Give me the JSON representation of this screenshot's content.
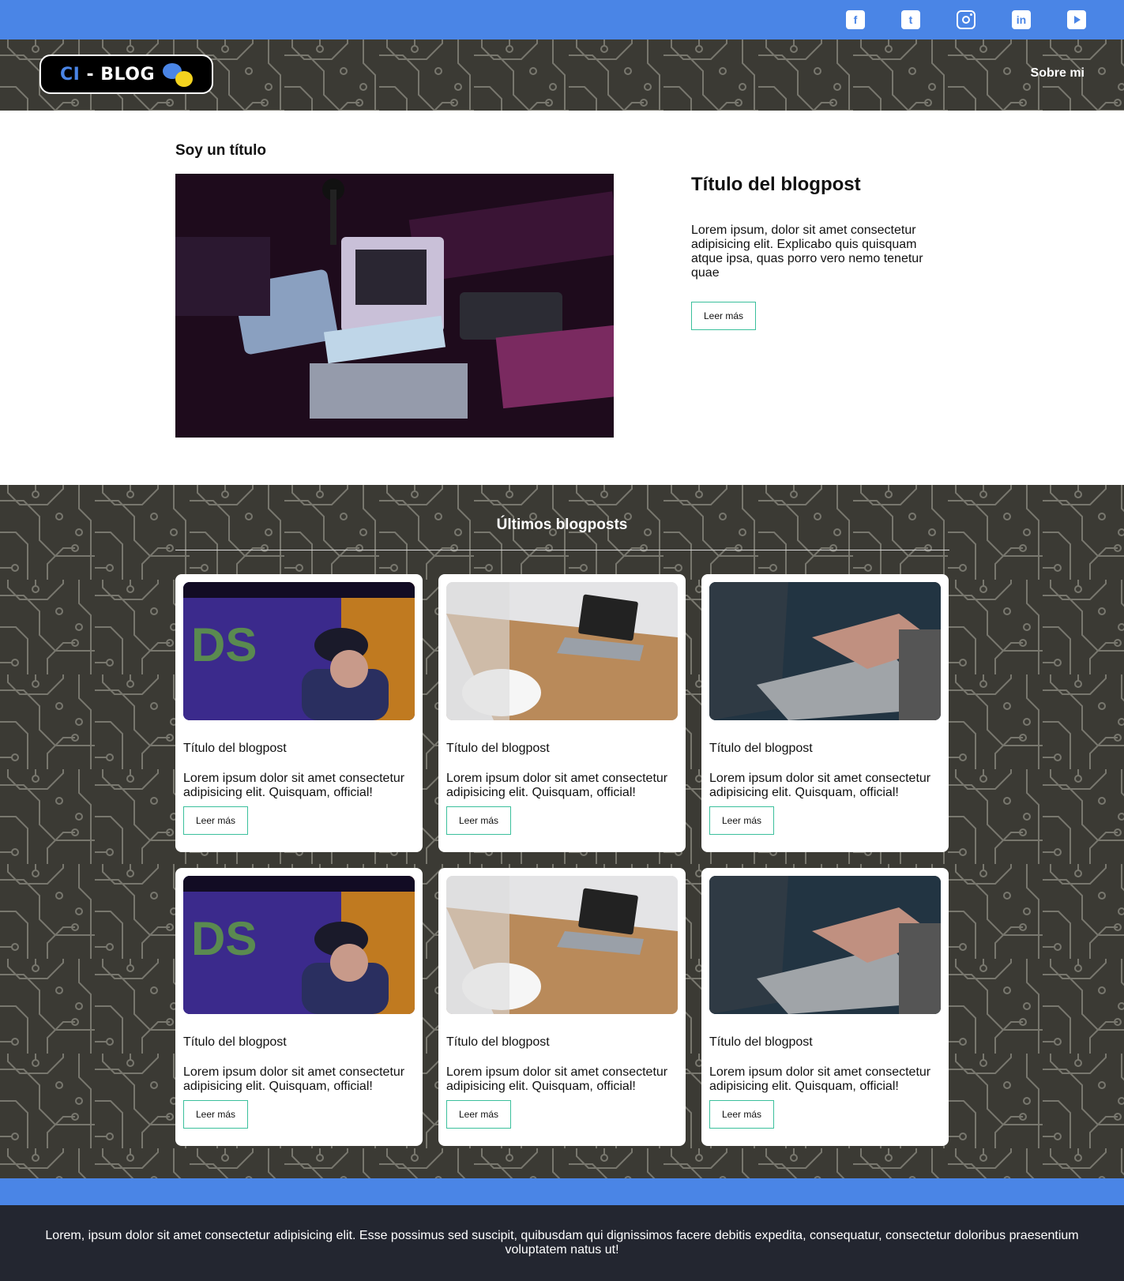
{
  "social": {
    "facebook": {
      "icon": "facebook-icon",
      "glyph": "f"
    },
    "twitter": {
      "icon": "twitter-icon",
      "glyph": "t"
    },
    "instagram": {
      "icon": "instagram-icon"
    },
    "linkedin": {
      "icon": "linkedin-icon",
      "glyph": "in"
    },
    "youtube": {
      "icon": "youtube-icon"
    }
  },
  "header": {
    "logo_prefix": "CI",
    "logo_rest": " - BLOG",
    "nav_link": "Sobre mi"
  },
  "featured": {
    "section_title": "Soy un título",
    "post_title": "Título del blogpost",
    "excerpt": "Lorem ipsum, dolor sit amet consectetur adipisicing elit. Explicabo quis quisquam atque ipsa, quas porro vero nemo tenetur quae",
    "button_label": "Leer más"
  },
  "latest": {
    "title": "Últimos blogposts",
    "cards": [
      {
        "title": "Título del blogpost",
        "text": "Lorem ipsum dolor sit amet consectetur adipisicing elit. Quisquam, official!",
        "button_label": "Leer más"
      },
      {
        "title": "Título del blogpost",
        "text": "Lorem ipsum dolor sit amet consectetur adipisicing elit. Quisquam, official!",
        "button_label": "Leer más"
      },
      {
        "title": "Título del blogpost",
        "text": "Lorem ipsum dolor sit amet consectetur adipisicing elit. Quisquam, official!",
        "button_label": "Leer más"
      },
      {
        "title": "Título del blogpost",
        "text": "Lorem ipsum dolor sit amet consectetur adipisicing elit. Quisquam, official!",
        "button_label": "Leer más"
      },
      {
        "title": "Título del blogpost",
        "text": "Lorem ipsum dolor sit amet consectetur adipisicing elit. Quisquam, official!",
        "button_label": "Leer más"
      },
      {
        "title": "Título del blogpost",
        "text": "Lorem ipsum dolor sit amet consectetur adipisicing elit. Quisquam, official!",
        "button_label": "Leer más"
      }
    ]
  },
  "footer": {
    "text": "Lorem, ipsum dolor sit amet consectetur adipisicing elit. Esse possimus sed suscipit, quibusdam qui dignissimos facere debitis expedita, consequatur, consectetur doloribus praesentium voluptatem natus ut!"
  },
  "colors": {
    "accent_blue": "#4a85e6",
    "button_border": "#3bc09c",
    "pattern_bg": "#3b3a34",
    "footer_bg": "#232630"
  }
}
